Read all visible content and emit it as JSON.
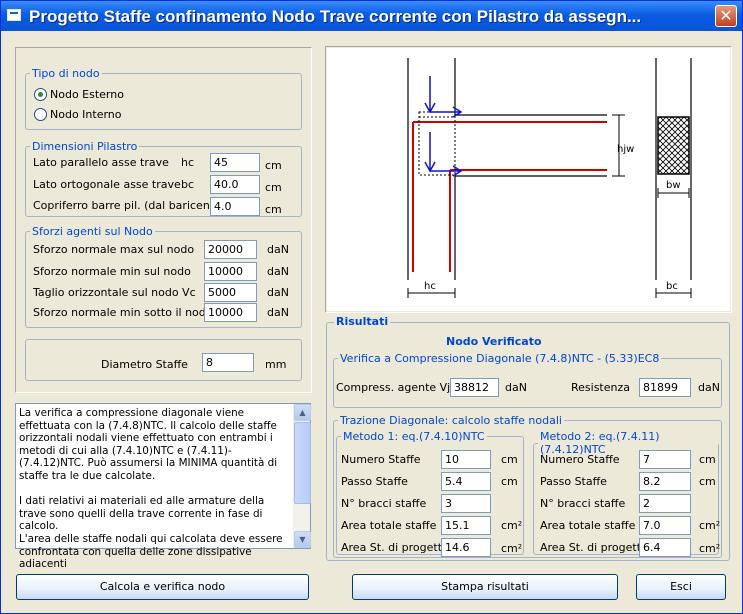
{
  "window": {
    "title": "Progetto Staffe confinamento Nodo Trave corrente con Pilastro da assegn...",
    "close_glyph": "✕"
  },
  "tipo_nodo": {
    "legend": "Tipo di nodo",
    "options": [
      {
        "label": "Nodo Esterno",
        "selected": true
      },
      {
        "label": "Nodo Interno",
        "selected": false
      }
    ]
  },
  "dimensioni": {
    "legend": "Dimensioni Pilastro",
    "rows": [
      {
        "label": "Lato  parallelo asse trave",
        "symbol": "hc",
        "value": "45",
        "unit": "cm"
      },
      {
        "label": "Lato  ortogonale asse trave",
        "symbol": "bc",
        "value": "40.0",
        "unit": "cm"
      },
      {
        "label": "Copriferro barre pil. (dal baricentro)",
        "symbol": "",
        "value": "4.0",
        "unit": "cm"
      }
    ]
  },
  "sforzi": {
    "legend": "Sforzi agenti sul Nodo",
    "rows": [
      {
        "label": "Sforzo normale max sul nodo",
        "value": "20000",
        "unit": "daN"
      },
      {
        "label": "Sforzo normale min sul nodo",
        "value": "10000",
        "unit": "daN"
      },
      {
        "label": "Taglio orizzontale sul nodo Vc",
        "value": "5000",
        "unit": "daN"
      },
      {
        "label": "Sforzo normale min sotto il nodo",
        "value": "10000",
        "unit": "daN"
      }
    ]
  },
  "diametro": {
    "label": "Diametro Staffe",
    "value": "8",
    "unit": "mm"
  },
  "note": {
    "text": "La verifica a compressione diagonale viene effettuata con la (7.4.8)NTC. Il calcolo delle staffe orizzontali nodali viene effettuato con entrambi i metodi di cui alla (7.4.10)NTC e (7.4.11)-(7.4.12)NTC. Può assumersi la MINIMA quantità di staffe tra le due calcolate.\n\nI dati relativi ai materiali ed alle armature della trave sono quelli della trave corrente in fase di calcolo.\nL'area delle staffe nodali qui calcolata deve essere confrontata con quella delle zone dissipative adiacenti"
  },
  "drawing": {
    "labels": {
      "hjw": "hjw",
      "bw": "bw",
      "hc": "hc",
      "bc": "bc"
    }
  },
  "risultati": {
    "legend": "Risultati",
    "status": "Nodo Verificato",
    "verifica": {
      "legend": "Verifica  a Compressione Diagonale (7.4.8)NTC - (5.33)EC8",
      "compress_label": "Compress. agente Vjbd",
      "compress_value": "38812",
      "compress_unit": "daN",
      "resist_label": "Resistenza",
      "resist_value": "81899",
      "resist_unit": "daN"
    },
    "trazione": {
      "legend": "Trazione Diagonale: calcolo staffe nodali",
      "metodo1": {
        "legend": "Metodo 1: eq.(7.4.10)NTC",
        "rows": [
          {
            "label": "Numero Staffe",
            "value": "10",
            "unit": "cm"
          },
          {
            "label": "Passo Staffe",
            "value": "5.4",
            "unit": "cm"
          },
          {
            "label": "N° bracci staffe",
            "value": "3",
            "unit": ""
          },
          {
            "label": "Area totale staffe",
            "value": "15.1",
            "unit": "cm²"
          },
          {
            "label": "Area St. di progetto",
            "value": "14.6",
            "unit": "cm²"
          }
        ]
      },
      "metodo2": {
        "legend": "Metodo 2: eq.(7.4.11) (7.4.12)NTC",
        "rows": [
          {
            "label": "Numero Staffe",
            "value": "7",
            "unit": "cm"
          },
          {
            "label": "Passo Staffe",
            "value": "8.2",
            "unit": "cm"
          },
          {
            "label": "N° bracci staffe",
            "value": "2",
            "unit": ""
          },
          {
            "label": "Area totale staffe",
            "value": "7.0",
            "unit": "cm²"
          },
          {
            "label": "Area St. di progetto",
            "value": "6.4",
            "unit": "cm²"
          }
        ]
      }
    }
  },
  "buttons": {
    "calcola": "Calcola e verifica nodo",
    "stampa": "Stampa risultati",
    "esci": "Esci"
  },
  "scroll": {
    "up": "▲",
    "down": "▼"
  }
}
